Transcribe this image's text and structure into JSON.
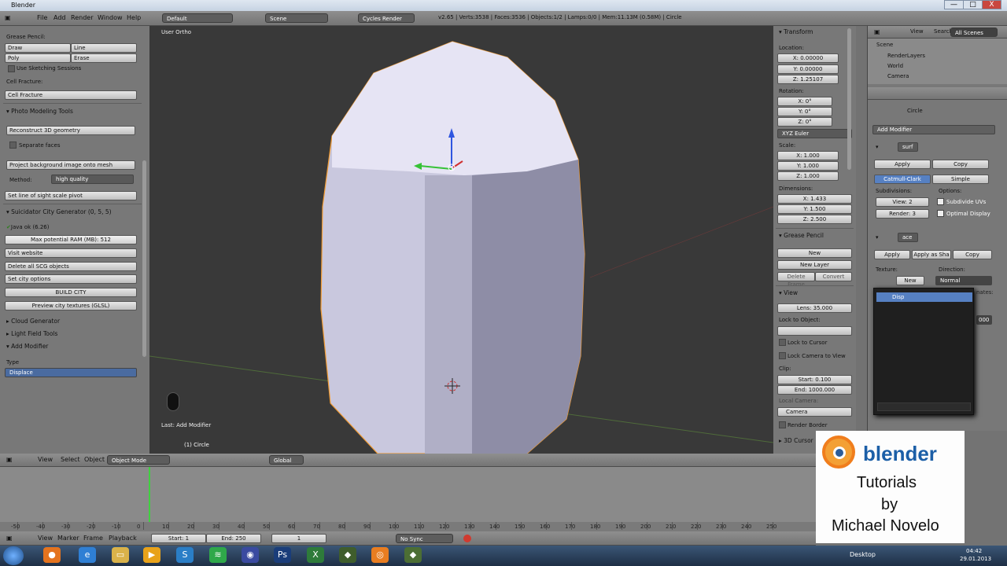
{
  "titlebar": {
    "title": "Blender",
    "min": "—",
    "max": "□",
    "close": "X"
  },
  "info_header": {
    "menus": [
      "File",
      "Add",
      "Render",
      "Window",
      "Help"
    ],
    "layout": "Default",
    "scene": "Scene",
    "engine": "Cycles Render",
    "stats": "v2.65 | Verts:3538 | Faces:3536 | Objects:1/2 | Lamps:0/0 | Mem:11.13M (0.58M) | Circle"
  },
  "left_panel": {
    "grease_pencil": "Grease Pencil:",
    "draw": "Draw",
    "line": "Line",
    "poly": "Poly",
    "erase": "Erase",
    "sketching": "Use Sketching Sessions",
    "cell_fracture_label": "Cell Fracture:",
    "cell_fracture_btn": "Cell Fracture",
    "photo_tools": "Photo Modeling Tools",
    "reconstruct": "Reconstruct 3D geometry",
    "separate": "Separate faces",
    "project": "Project background image onto mesh",
    "method_label": "Method:",
    "method_value": "high quality",
    "set_line": "Set line of sight scale pivot",
    "suicidator": "Suicidator City Generator (0, 5, 5)",
    "java": "Java ok (6.26)",
    "max_ram": "Max potential RAM (MB): 512",
    "visit": "Visit website",
    "delete_scg": "Delete all SCG objects",
    "city_options": "Set city options",
    "build_city": "BUILD CITY",
    "preview_textures": "Preview city textures (GLSL)",
    "cloud": "Cloud Generator",
    "light_field": "Light Field Tools",
    "add_modifier": "Add Modifier",
    "type_label": "Type",
    "type_value": "Displace"
  },
  "viewport": {
    "label": "User Ortho",
    "last_op": "Last: Add Modifier",
    "object": "(1) Circle"
  },
  "properties_panel": {
    "transform": "Transform",
    "location": "Location:",
    "loc_x": "X: 0.00000",
    "loc_y": "Y: 0.00000",
    "loc_z": "Z: 1.25107",
    "rotation": "Rotation:",
    "rot_x": "X: 0°",
    "rot_y": "Y: 0°",
    "rot_z": "Z: 0°",
    "euler": "XYZ Euler",
    "scale": "Scale:",
    "sc_x": "X: 1.000",
    "sc_y": "Y: 1.000",
    "sc_z": "Z: 1.000",
    "dimensions": "Dimensions:",
    "dim_x": "X: 1.433",
    "dim_y": "Y: 1.500",
    "dim_z": "Z: 2.500",
    "grease": "Grease Pencil",
    "new": "New",
    "new_layer": "New Layer",
    "delete_frame": "Delete Frame",
    "convert": "Convert",
    "view": "View",
    "lens": "Lens: 35.000",
    "lock_obj": "Lock to Object:",
    "lock_cursor": "Lock to Cursor",
    "lock_camera": "Lock Camera to View",
    "clip": "Clip:",
    "clip_start": "Start: 0.100",
    "clip_end": "End: 1000.000",
    "local_camera": "Local Camera:",
    "camera": "Camera",
    "render_border": "Render Border",
    "cursor": "3D Cursor"
  },
  "outliner": {
    "view": "View",
    "search": "Search",
    "scenes": "All Scenes",
    "items": [
      "Scene",
      "RenderLayers",
      "World",
      "Camera"
    ]
  },
  "modifiers": {
    "object": "Circle",
    "add_modifier": "Add Modifier",
    "surf": "surf",
    "apply": "Apply",
    "copy": "Copy",
    "catmull": "Catmull-Clark",
    "simple": "Simple",
    "subdivisions": "Subdivisions:",
    "options": "Options:",
    "view": "View: 2",
    "render": "Render: 3",
    "subdivide_uvs": "Subdivide UVs",
    "optimal": "Optimal Display",
    "ace": "ace",
    "apply2": "Apply",
    "apply_shape": "Apply as Sha",
    "copy2": "Copy",
    "texture": "Texture:",
    "direction": "Direction:",
    "tex_new": "New",
    "direction_value": "Normal",
    "dropdown_item": "Disp",
    "partial1": "nates:",
    "partial2": "000"
  },
  "timeline": {
    "menus": [
      "View",
      "Marker",
      "Frame",
      "Playback"
    ],
    "start": "Start: 1",
    "end": "End: 250",
    "current": "1",
    "sync": "No Sync",
    "ticks": [
      "-50",
      "-40",
      "-30",
      "-20",
      "-10",
      "0",
      "10",
      "20",
      "30",
      "40",
      "50",
      "60",
      "70",
      "80",
      "90",
      "100",
      "110",
      "120",
      "130",
      "140",
      "150",
      "160",
      "170",
      "180",
      "190",
      "200",
      "210",
      "220",
      "230",
      "240",
      "250"
    ]
  },
  "viewport_header": {
    "menus": [
      "View",
      "Select",
      "Object"
    ],
    "mode": "Object Mode",
    "orientation": "Global"
  },
  "watermark": {
    "brand": "blender",
    "line1": "Tutorials",
    "line2": "by",
    "line3": "Michael Novelo"
  },
  "taskbar": {
    "desktop": "Desktop",
    "time": "04:42",
    "date": "29.01.2013"
  },
  "colors": {
    "orange": "#f39c32",
    "selected": "#5680c2",
    "panel": "#787878",
    "viewport": "#393939"
  }
}
